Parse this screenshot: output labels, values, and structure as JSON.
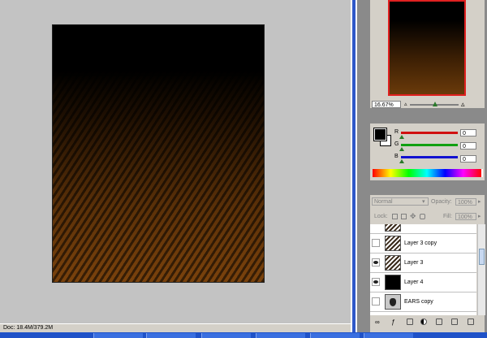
{
  "status": {
    "doc_info": "Doc: 18.4M/379.2M"
  },
  "navigator": {
    "zoom": "16.67%"
  },
  "color": {
    "channels": [
      {
        "label": "R",
        "value": "0",
        "color": "#d01010"
      },
      {
        "label": "G",
        "value": "0",
        "color": "#10a010"
      },
      {
        "label": "B",
        "value": "0",
        "color": "#1010d0"
      }
    ],
    "foreground": "#000000",
    "background": "#ffffff"
  },
  "layers": {
    "blend_mode": "Normal",
    "opacity_label": "Opacity:",
    "opacity_value": "100%",
    "lock_label": "Lock:",
    "fill_label": "Fill:",
    "fill_value": "100%",
    "items": [
      {
        "name": "Layer 3 copy",
        "visible": false,
        "thumb": "stripe"
      },
      {
        "name": "Layer 3",
        "visible": true,
        "thumb": "stripe"
      },
      {
        "name": "Layer 4",
        "visible": true,
        "thumb": "black"
      },
      {
        "name": "EARS copy",
        "visible": false,
        "thumb": "ears"
      }
    ]
  }
}
